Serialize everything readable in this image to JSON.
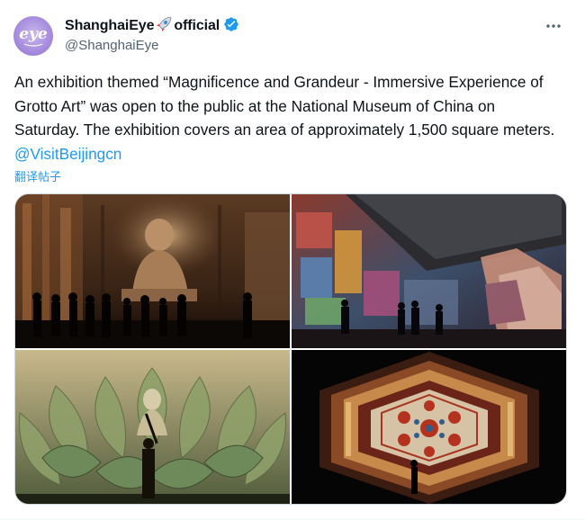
{
  "author": {
    "display_name": "ShanghaiEye",
    "name_emoji": "rocket-icon",
    "display_name_suffix": "official",
    "handle": "@ShanghaiEye",
    "avatar_text": "eye"
  },
  "tweet": {
    "text": "An exhibition themed “Magnificence and Grandeur - Immersive Experience of Grotto Art” was open to the public at the National Museum of China on Saturday. The exhibition covers an area of approximately 1,500 square meters. ",
    "mention": "@VisitBeijingcn",
    "translate_label": "翻译帖子"
  },
  "media": {
    "count": 4,
    "photos": [
      {
        "subject": "grotto-buddha-projection"
      },
      {
        "subject": "immersive-mural-hall"
      },
      {
        "subject": "lotus-buddha-installation"
      },
      {
        "subject": "hexagonal-kaleidoscope-tunnel"
      }
    ]
  },
  "colors": {
    "accent": "#1d9bf0",
    "text": "#0f1419",
    "secondary": "#536471"
  }
}
